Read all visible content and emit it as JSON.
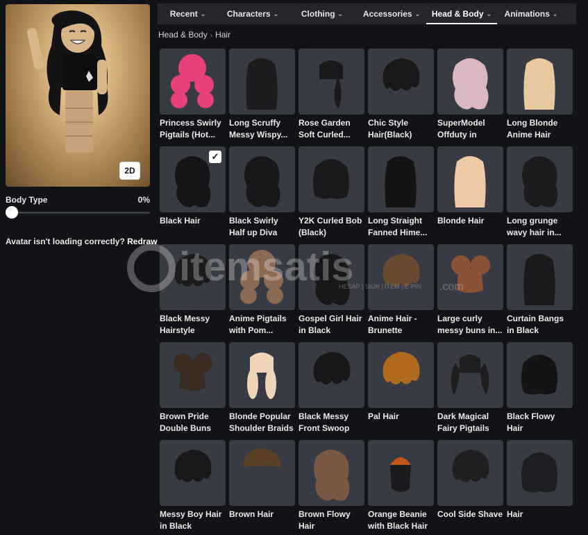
{
  "nav": {
    "tabs": [
      {
        "label": "Recent"
      },
      {
        "label": "Characters"
      },
      {
        "label": "Clothing"
      },
      {
        "label": "Accessories"
      },
      {
        "label": "Head & Body"
      },
      {
        "label": "Animations"
      }
    ],
    "active_tab": "Head & Body"
  },
  "breadcrumb": {
    "parent": "Head & Body",
    "current": "Hair"
  },
  "preview": {
    "view_toggle_label": "2D"
  },
  "body_type": {
    "label": "Body Type",
    "value": "0%",
    "level": 0
  },
  "redraw": {
    "prompt": "Avatar isn't loading correctly?",
    "link_label": "Redraw"
  },
  "watermark": {
    "brand": "itemsatis",
    "tagline": "HESAP | SKIN | ITEM | E-PIN",
    "tld": ".com"
  },
  "items": [
    {
      "name": "Princess Swirly Pigtails (Hot...",
      "color": "#e8407a",
      "style": "curly"
    },
    {
      "name": "Long Scruffy Messy Wispy...",
      "color": "#1c1c1e",
      "style": "long"
    },
    {
      "name": "Rose Garden Soft Curled...",
      "color": "#1a1a1c",
      "style": "side"
    },
    {
      "name": "Chic Style Hair(Black)",
      "color": "#19191b",
      "style": "short"
    },
    {
      "name": "SuperModel Offduty in Ligh...",
      "color": "#d9b8c4",
      "style": "wavy"
    },
    {
      "name": "Long Blonde Anime Hair",
      "color": "#e8c9a0",
      "style": "long"
    },
    {
      "name": "Black Hair",
      "color": "#151517",
      "style": "wavy",
      "selected": true
    },
    {
      "name": "Black Swirly Half up Diva Hair",
      "color": "#18181a",
      "style": "wavy"
    },
    {
      "name": "Y2K Curled Bob (Black)",
      "color": "#1a1a1c",
      "style": "bob"
    },
    {
      "name": "Long Straight Fanned Hime...",
      "color": "#141416",
      "style": "long"
    },
    {
      "name": "Blonde Hair",
      "color": "#efcaa8",
      "style": "long"
    },
    {
      "name": "Long grunge wavy hair in...",
      "color": "#1c1c1e",
      "style": "wavy"
    },
    {
      "name": "Black Messy Hairstyle",
      "color": "#1b1b1d",
      "style": "short"
    },
    {
      "name": "Anime Pigtails with Pom...",
      "color": "#8a6a52",
      "style": "curly"
    },
    {
      "name": "Gospel Girl Hair in Black",
      "color": "#18181a",
      "style": "wavy"
    },
    {
      "name": "Anime Hair - Brunette",
      "color": "#6b4a32",
      "style": "short"
    },
    {
      "name": "Large curly messy buns in...",
      "color": "#8a5236",
      "style": "buns"
    },
    {
      "name": "Curtain Bangs in Black",
      "color": "#1a1a1c",
      "style": "long"
    },
    {
      "name": "Brown Pride Double Buns",
      "color": "#3a2c22",
      "style": "buns"
    },
    {
      "name": "Blonde Popular Shoulder Braids",
      "color": "#f0d6b8",
      "style": "braids"
    },
    {
      "name": "Black Messy Front Swoop",
      "color": "#17171a",
      "style": "short"
    },
    {
      "name": "Pal Hair",
      "color": "#b06a1e",
      "style": "short"
    },
    {
      "name": "Dark Magical Fairy Pigtails",
      "color": "#1e1e20",
      "style": "pigtails"
    },
    {
      "name": "Black Flowy Hair",
      "color": "#141416",
      "style": "bob"
    },
    {
      "name": "Messy Boy Hair in Black",
      "color": "#19191b",
      "style": "short"
    },
    {
      "name": "Brown Hair",
      "color": "#5a4024",
      "style": "bun-top"
    },
    {
      "name": "Brown Flowy Hair",
      "color": "#7a5846",
      "style": "wavy"
    },
    {
      "name": "Orange Beanie with Black Hair",
      "color": "#1b1b1d",
      "style": "beanie",
      "accent": "#c2541e"
    },
    {
      "name": "Cool Side Shave",
      "color": "#1f1f22",
      "style": "short"
    },
    {
      "name": "Hair",
      "color": "#1d1e22",
      "style": "bob"
    }
  ]
}
